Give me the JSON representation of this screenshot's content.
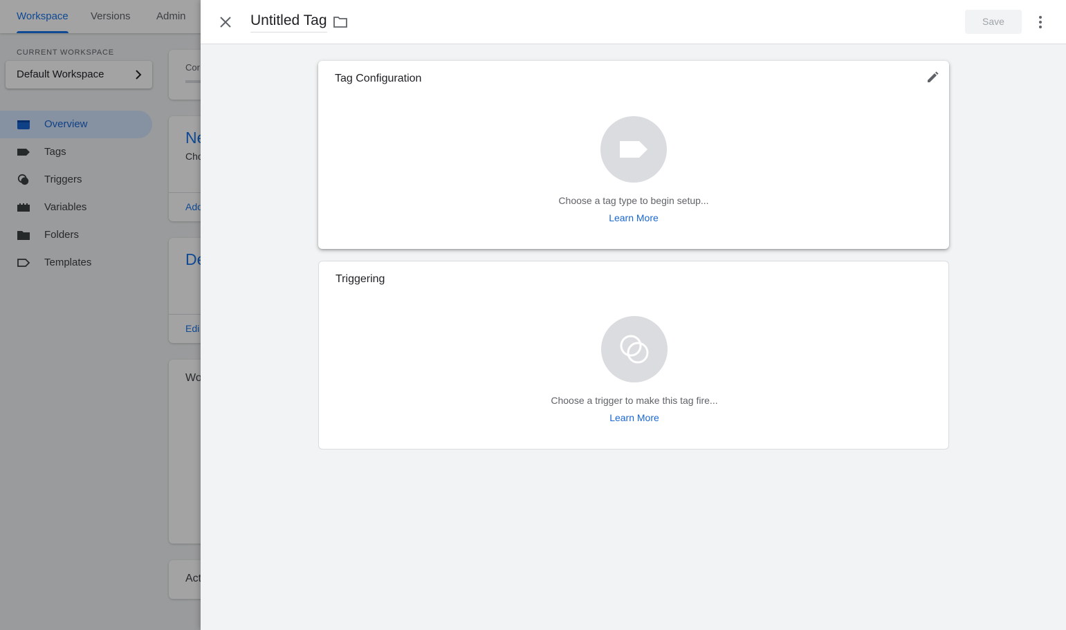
{
  "background": {
    "tabs": [
      "Workspace",
      "Versions",
      "Admin"
    ],
    "current_workspace_label": "CURRENT WORKSPACE",
    "workspace_name": "Default Workspace",
    "nav": [
      "Overview",
      "Tags",
      "Triggers",
      "Variables",
      "Folders",
      "Templates"
    ],
    "card_fragments": [
      "Cor",
      "Ne",
      "Cho",
      "Ado",
      "De",
      "Edi",
      "Wo",
      "Act"
    ]
  },
  "sheet": {
    "title": "Untitled Tag",
    "save_label": "Save",
    "tag_config": {
      "title": "Tag Configuration",
      "description": "Choose a tag type to begin setup...",
      "link": "Learn More"
    },
    "triggering": {
      "title": "Triggering",
      "description": "Choose a trigger to make this tag fire...",
      "link": "Learn More"
    }
  },
  "colors": {
    "accent": "#1a73e8",
    "link": "#1967d2",
    "nav_active_bg": "#d2e3fc",
    "icon_circle": "#dadce0"
  }
}
